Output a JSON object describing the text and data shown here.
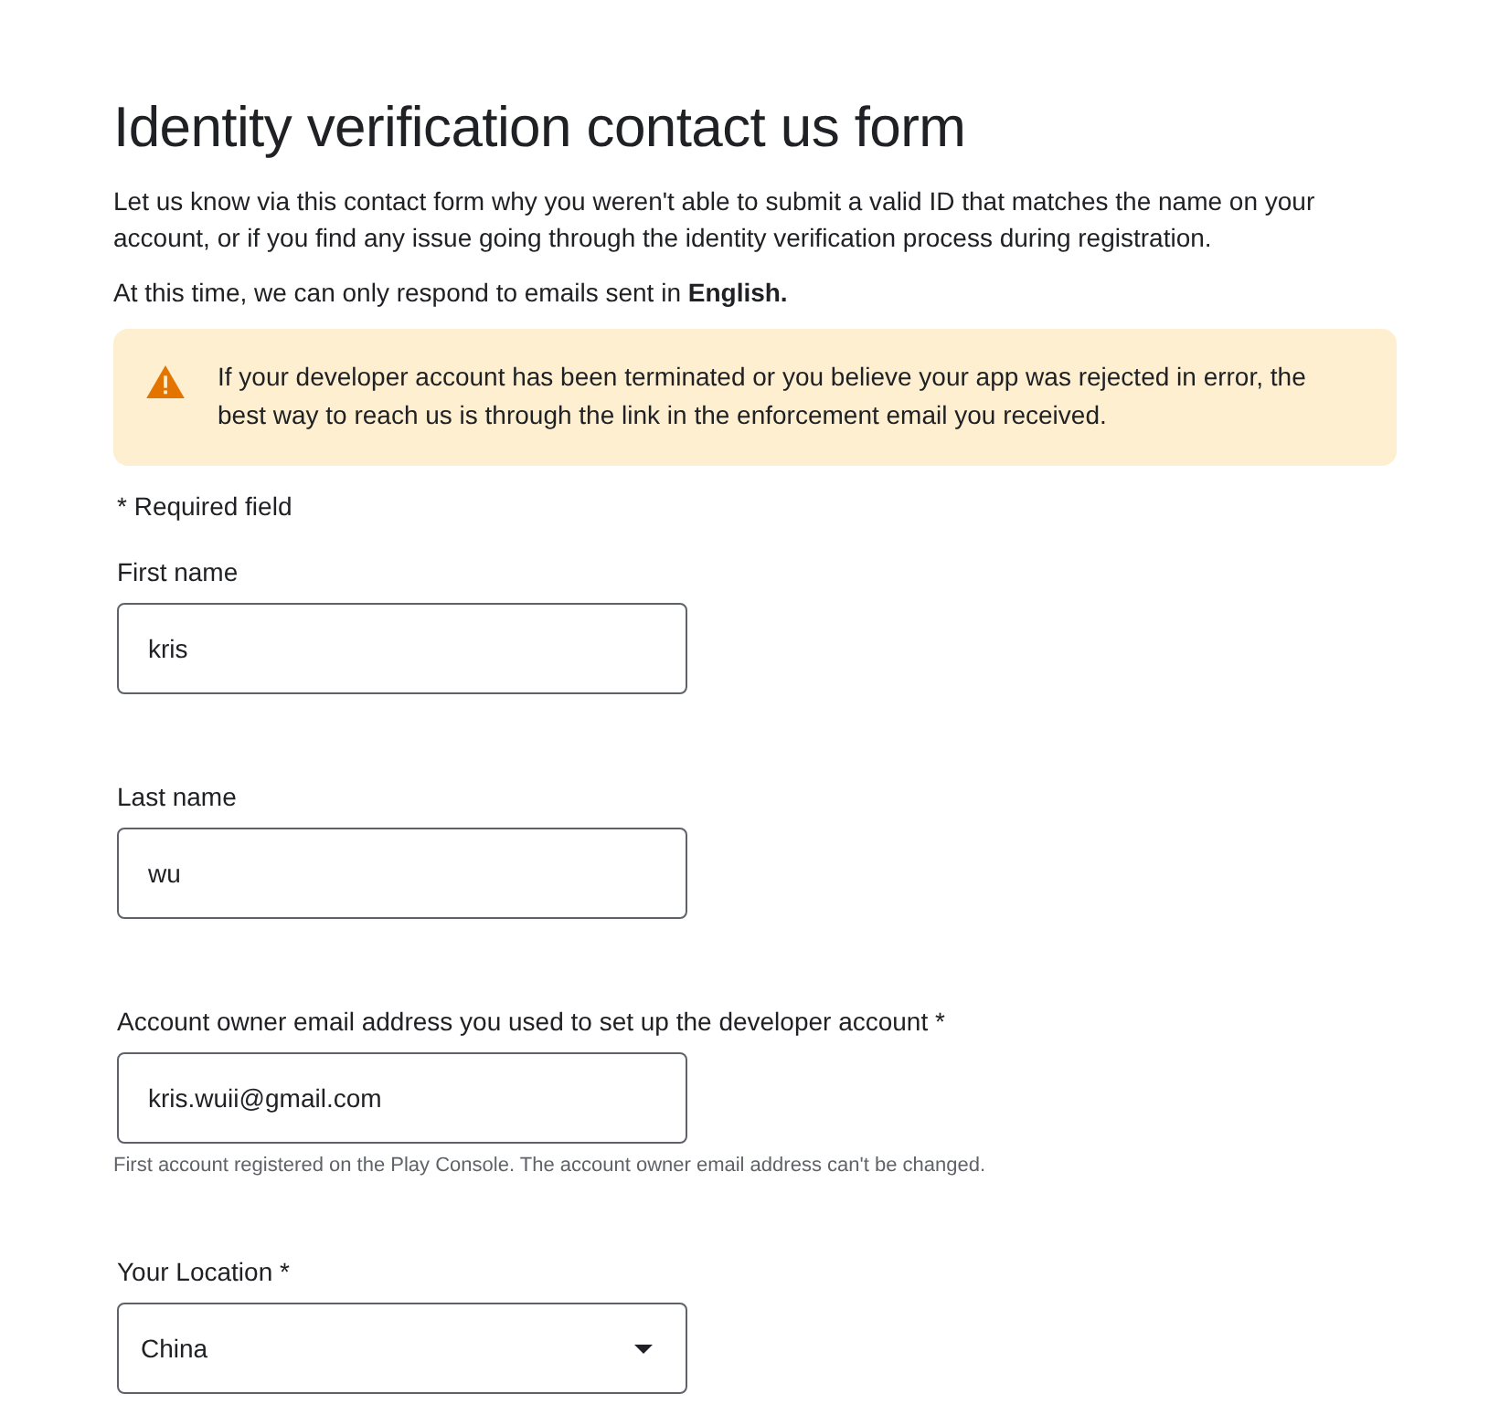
{
  "title": "Identity verification contact us form",
  "intro": "Let us know via this contact form why you weren't able to submit a valid ID that matches the name on your account, or if you find any issue going through the identity verification process during registration.",
  "language_note": "At this time, we can only respond to emails sent in **English.**",
  "warning": "If your developer account has been terminated or you believe your app was rejected in error, the best way to reach us is through the link in the enforcement email you received.",
  "required_note": "* Required field",
  "fields": [
    {
      "kind": "text",
      "label": "First name",
      "value": "kris"
    },
    {
      "kind": "text",
      "label": "Last name",
      "value": "wu"
    },
    {
      "kind": "text",
      "label": "Account owner email address you used to set up the developer account *",
      "value": "kris.wuii@gmail.com",
      "hint": "First account registered on the Play Console. The account owner email address can't be changed."
    },
    {
      "kind": "select",
      "label": "Your Location *",
      "value": "China"
    }
  ]
}
